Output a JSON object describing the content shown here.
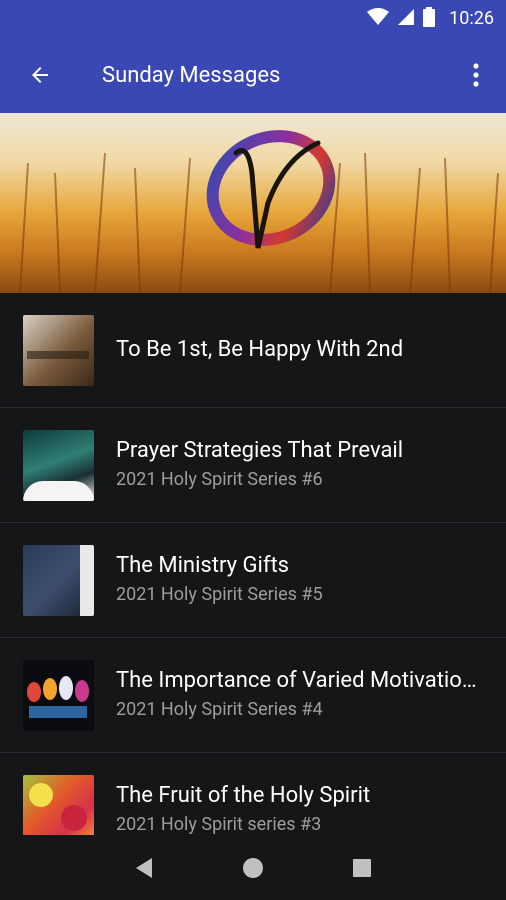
{
  "status_bar": {
    "time": "10:26"
  },
  "app_bar": {
    "title": "Sunday Messages"
  },
  "messages": [
    {
      "title": "To Be 1st, Be Happy With 2nd",
      "subtitle": ""
    },
    {
      "title": "Prayer Strategies That Prevail",
      "subtitle": "2021 Holy Spirit Series #6"
    },
    {
      "title": "The Ministry Gifts",
      "subtitle": "2021 Holy Spirit Series #5"
    },
    {
      "title": "The Importance of Varied Motivations",
      "subtitle": "2021 Holy Spirit Series #4"
    },
    {
      "title": "The Fruit of the Holy Spirit",
      "subtitle": "2021 Holy Spirit series #3"
    }
  ],
  "colors": {
    "app_bar": "#3a48b4",
    "background": "#151618",
    "subtitle": "#9c9d9f"
  }
}
